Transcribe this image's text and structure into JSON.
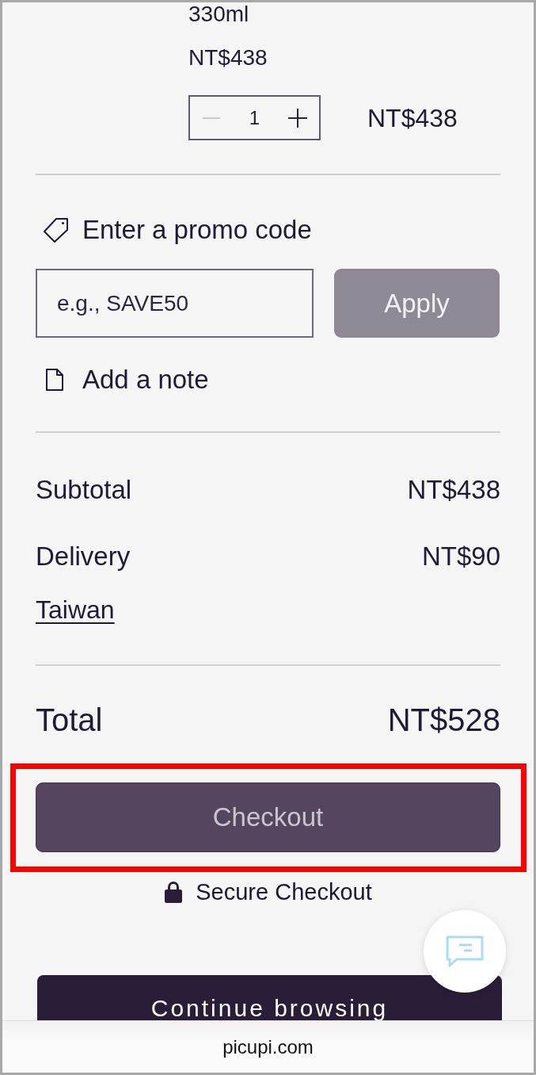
{
  "product": {
    "size": "330ml",
    "unit_price": "NT$438",
    "quantity": "1",
    "decrease_disabled": true,
    "line_total": "NT$438"
  },
  "promo": {
    "label": "Enter a promo code",
    "placeholder": "e.g., SAVE50",
    "apply": {
      "label": "Apply",
      "disabled": true
    }
  },
  "note": {
    "label": "Add a note"
  },
  "summary": {
    "rows": [
      {
        "label": "Subtotal",
        "value": "NT$438"
      },
      {
        "label": "Delivery",
        "value": "NT$90"
      }
    ],
    "region_link": "Taiwan"
  },
  "total": {
    "label": "Total",
    "value": "NT$528"
  },
  "checkout": {
    "label": "Checkout",
    "highlighted": true
  },
  "secure": {
    "label": "Secure Checkout"
  },
  "continue_button": {
    "label": "Continue browsing"
  },
  "browser": {
    "address": "picupi.com"
  }
}
